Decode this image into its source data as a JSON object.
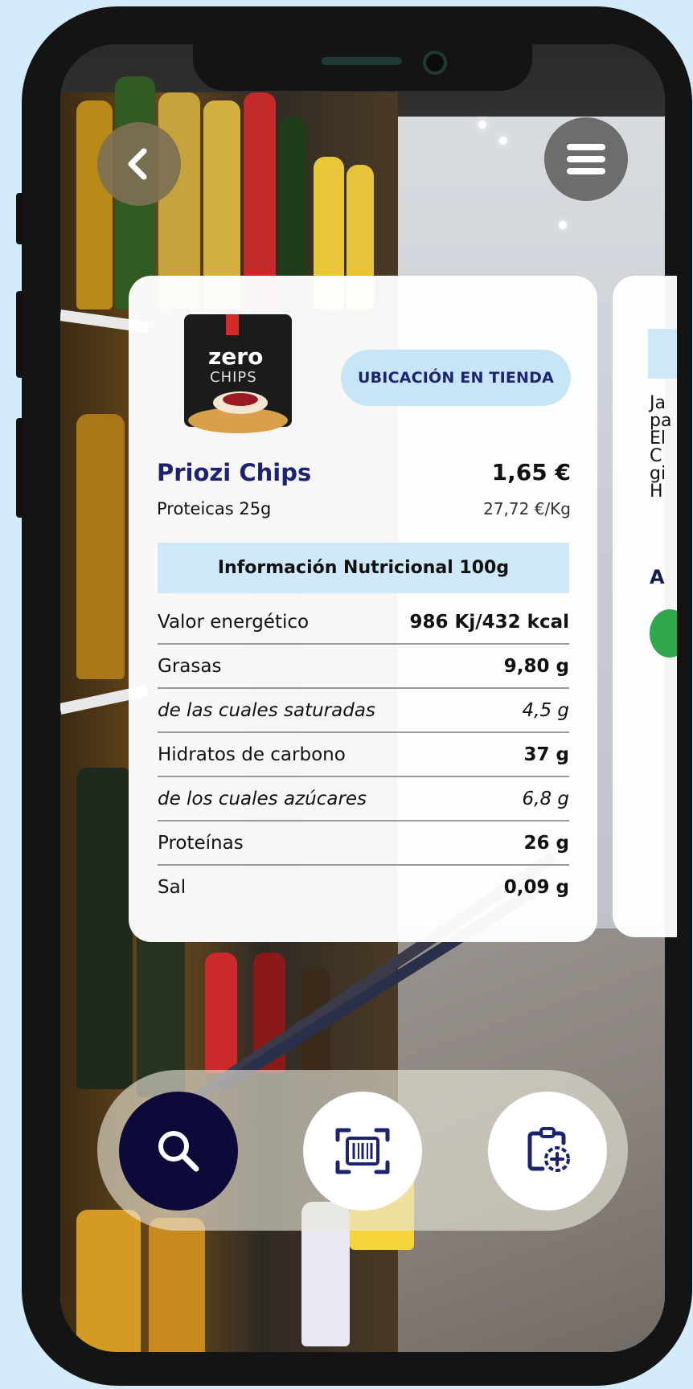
{
  "nav": {
    "back_icon": "chevron-left-icon",
    "menu_icon": "hamburger-menu-icon"
  },
  "product": {
    "name": "Priozi Chips",
    "subtitle": "Proteicas 25g",
    "price": "1,65 €",
    "unit_price": "27,72 €/Kg",
    "image_label_top": "zero",
    "image_label_bottom": "CHIPS",
    "location_button": "UBICACIÓN EN TIENDA"
  },
  "nutrition": {
    "title": "Información Nutricional 100g",
    "rows": [
      {
        "label": "Valor energético",
        "value": "986 Kj/432 kcal",
        "sub": false
      },
      {
        "label": "Grasas",
        "value": "9,80 g",
        "sub": false
      },
      {
        "label": "de las cuales saturadas",
        "value": "4,5 g",
        "sub": true
      },
      {
        "label": "Hidratos de carbono",
        "value": "37 g",
        "sub": false
      },
      {
        "label": "de los cuales azúcares",
        "value": "6,8 g",
        "sub": true
      },
      {
        "label": "Proteínas",
        "value": "26 g",
        "sub": false
      },
      {
        "label": "Sal",
        "value": "0,09 g",
        "sub": false
      }
    ]
  },
  "next_card": {
    "text": "Ja\npa\nEl\nC\ngi\nH",
    "heading": "A"
  },
  "toolbar": {
    "search_icon": "search-icon",
    "scan_icon": "barcode-scan-icon",
    "add_icon": "clipboard-add-icon"
  },
  "colors": {
    "background": "#d4ecfa",
    "accent_navy": "#1c2470",
    "search_button": "#0d0a3a",
    "light_blue": "#cfe8f7"
  }
}
